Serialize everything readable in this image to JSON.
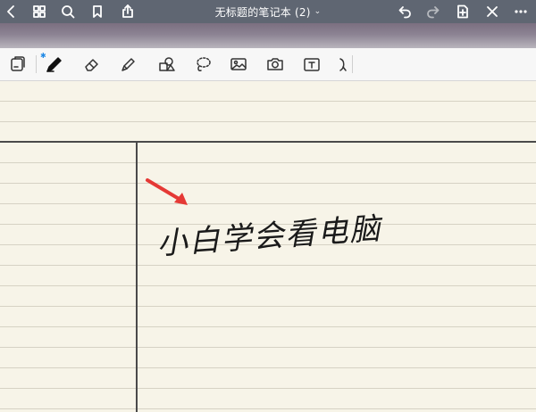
{
  "navbar": {
    "title": "无标题的笔记本 (2)",
    "title_caret": "⌄",
    "icons": [
      "back-icon",
      "grid-icon",
      "search-icon",
      "bookmark-icon",
      "share-icon",
      "undo-icon",
      "redo-icon",
      "add-page-icon",
      "close-icon",
      "more-icon"
    ]
  },
  "toolbar": {
    "tools": [
      "page-toggle-icon",
      "pen-icon",
      "eraser-icon",
      "highlighter-icon",
      "shapes-icon",
      "lasso-icon",
      "image-icon",
      "camera-icon",
      "text-icon",
      "laser-icon"
    ],
    "bluetooth_mark": "✱",
    "colors": [
      "#d91e1e",
      "#111111",
      "#1e7be6"
    ],
    "selected_color": "#111111",
    "stroke_widths": [
      "thin",
      "medium",
      "thick"
    ],
    "selected_stroke": "thin",
    "accent_color": "#e53935"
  },
  "note": {
    "handwriting_text": "小白学会看电脑"
  }
}
